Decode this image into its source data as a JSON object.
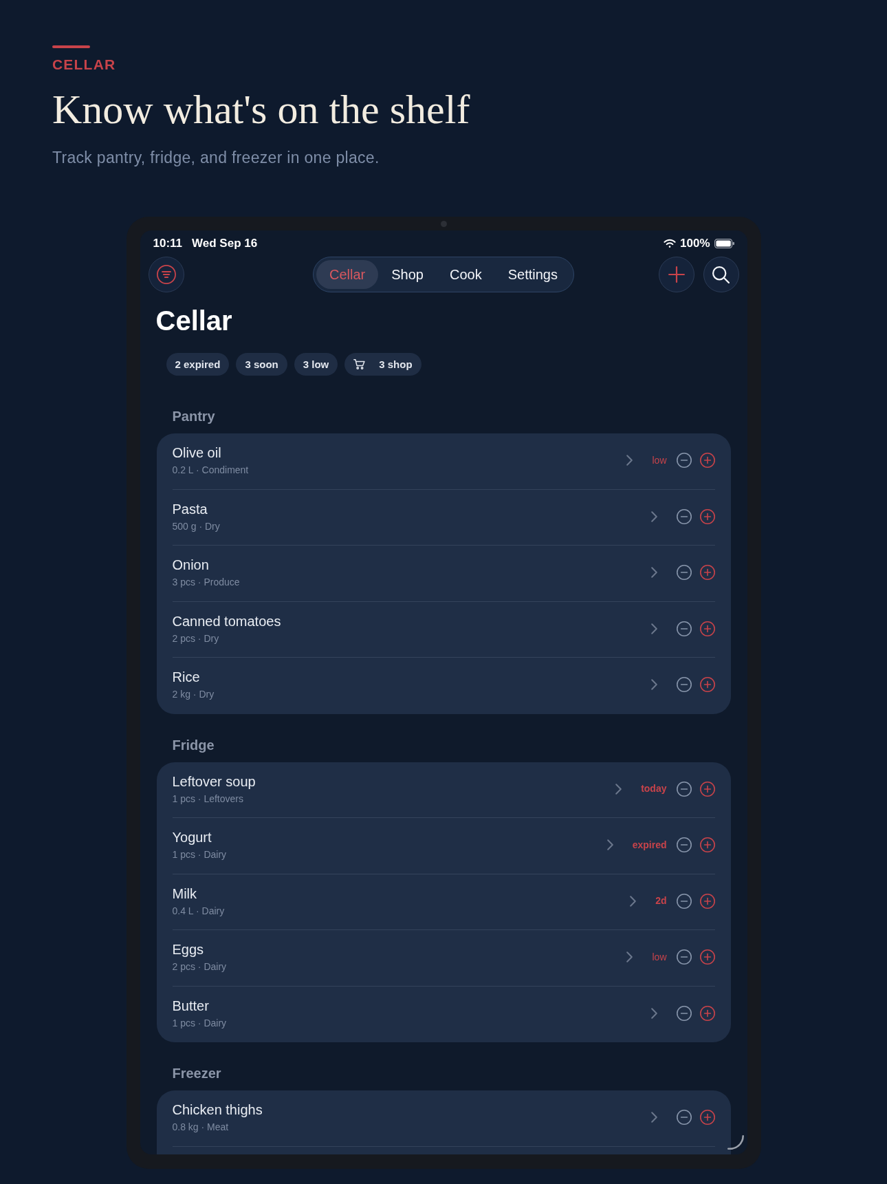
{
  "hero": {
    "eyebrow": "CELLAR",
    "title": "Know what's on the shelf",
    "subtitle": "Track pantry, fridge, and freezer in one place."
  },
  "status_bar": {
    "time": "10:11",
    "date": "Wed Sep 16",
    "battery": "100%"
  },
  "tabs": [
    {
      "label": "Cellar",
      "selected": true
    },
    {
      "label": "Shop",
      "selected": false
    },
    {
      "label": "Cook",
      "selected": false
    },
    {
      "label": "Settings",
      "selected": false
    }
  ],
  "page_title": "Cellar",
  "chips": [
    {
      "label": "2 expired",
      "kind": "plain"
    },
    {
      "label": "3 soon",
      "kind": "plain"
    },
    {
      "label": "3 low",
      "kind": "plain"
    },
    {
      "label": "3 shop",
      "kind": "cart"
    }
  ],
  "sections": [
    {
      "title": "Pantry",
      "cut_off": false,
      "items": [
        {
          "name": "Olive oil",
          "detail": "0.2 L · Condiment",
          "badge": {
            "kind": "stock",
            "text": "low"
          }
        },
        {
          "name": "Pasta",
          "detail": "500 g · Dry"
        },
        {
          "name": "Onion",
          "detail": "3 pcs · Produce"
        },
        {
          "name": "Canned tomatoes",
          "detail": "2 pcs · Dry"
        },
        {
          "name": "Rice",
          "detail": "2 kg · Dry"
        }
      ]
    },
    {
      "title": "Fridge",
      "cut_off": false,
      "items": [
        {
          "name": "Leftover soup",
          "detail": "1 pcs · Leftovers",
          "badge": {
            "kind": "expiry",
            "text": "today"
          }
        },
        {
          "name": "Yogurt",
          "detail": "1 pcs · Dairy",
          "badge": {
            "kind": "expiry",
            "text": "expired"
          }
        },
        {
          "name": "Milk",
          "detail": "0.4 L · Dairy",
          "badge": {
            "kind": "expiry",
            "text": "2d"
          }
        },
        {
          "name": "Eggs",
          "detail": "2 pcs · Dairy",
          "badge": {
            "kind": "stock",
            "text": "low"
          }
        },
        {
          "name": "Butter",
          "detail": "1 pcs · Dairy"
        }
      ]
    },
    {
      "title": "Freezer",
      "cut_off": true,
      "items": [
        {
          "name": "Chicken thighs",
          "detail": "0.8 kg · Meat"
        }
      ]
    }
  ]
}
